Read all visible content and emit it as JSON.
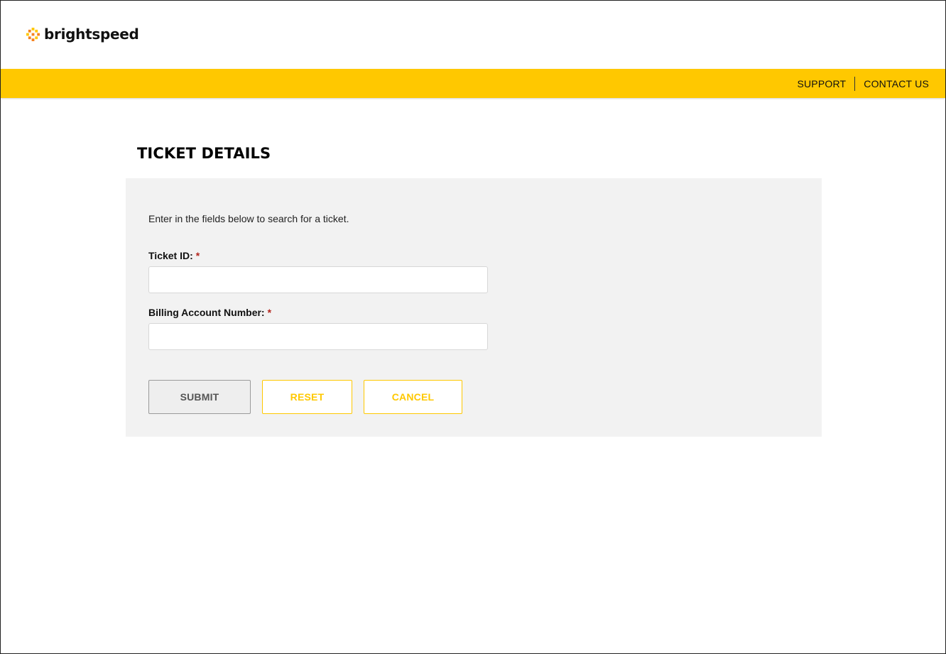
{
  "brand": {
    "name": "brightspeed",
    "logo_icon": "brightspeed-logo-icon",
    "logo_colors": [
      "#ffc800",
      "#f5821f"
    ]
  },
  "nav": {
    "links": [
      {
        "label": "SUPPORT"
      },
      {
        "label": "CONTACT US"
      }
    ]
  },
  "page": {
    "title": "TICKET DETAILS",
    "intro": "Enter in the fields below to search for a ticket."
  },
  "form": {
    "required_marker": "*",
    "ticket_id": {
      "label": "Ticket ID:",
      "value": "",
      "placeholder": ""
    },
    "billing_account": {
      "label": "Billing Account Number:",
      "value": "",
      "placeholder": ""
    },
    "buttons": {
      "submit": "SUBMIT",
      "reset": "RESET",
      "cancel": "CANCEL"
    }
  },
  "colors": {
    "accent": "#ffc800",
    "panel_bg": "#f2f2f2",
    "required": "#b3261e"
  }
}
